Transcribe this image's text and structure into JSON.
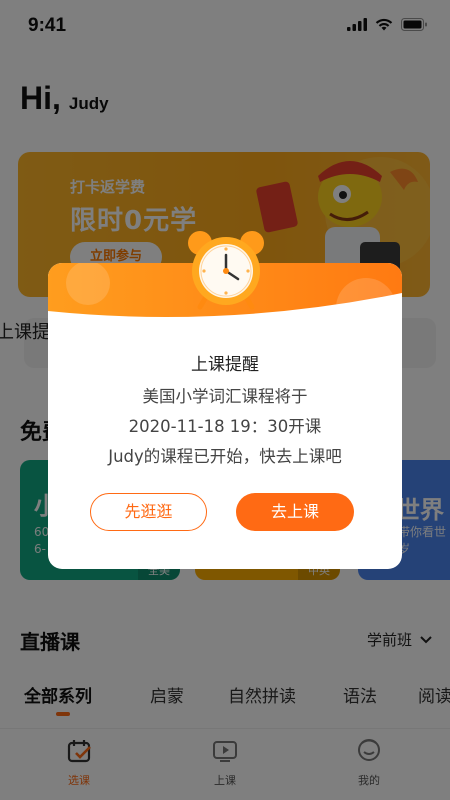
{
  "status": {
    "time": "9:41"
  },
  "greeting": {
    "hi": "Hi,",
    "name": "Judy"
  },
  "banner": {
    "subtitle": "打卡返学费",
    "title": "限时0元学",
    "button": "立即参与"
  },
  "upcoming": {
    "title": "上课提"
  },
  "free_section": {
    "title": "免费"
  },
  "course_cards": [
    {
      "title": "小",
      "desc": "60\n6-",
      "tag": "全美"
    },
    {
      "title": "",
      "desc": "",
      "tag": "中英"
    },
    {
      "title": "世界",
      "desc": "带你看世\n岁",
      "tag": ""
    }
  ],
  "live": {
    "title": "直播课",
    "grade": "学前班"
  },
  "tabs": [
    {
      "label": "全部系列",
      "active": true
    },
    {
      "label": "启蒙",
      "active": false
    },
    {
      "label": "自然拼读",
      "active": false
    },
    {
      "label": "语法",
      "active": false
    },
    {
      "label": "阅读",
      "active": false
    }
  ],
  "bottom_nav": [
    {
      "label": "选课",
      "icon": "calendar-check-icon",
      "active": true
    },
    {
      "label": "上课",
      "icon": "play-screen-icon",
      "active": false
    },
    {
      "label": "我的",
      "icon": "face-icon",
      "active": false
    }
  ],
  "modal": {
    "title": "上课提醒",
    "line1": "美国小学词汇课程将于",
    "line2": "2020-11-18 19：30开课",
    "line3": "Judy的课程已开始，快去上课吧",
    "browse_button": "先逛逛",
    "go_button": "去上课"
  },
  "colors": {
    "accent": "#ff6a14",
    "banner": "#ffb629",
    "card_green": "#11a982",
    "card_yellow": "#ffae00",
    "card_blue": "#4a84ee"
  }
}
